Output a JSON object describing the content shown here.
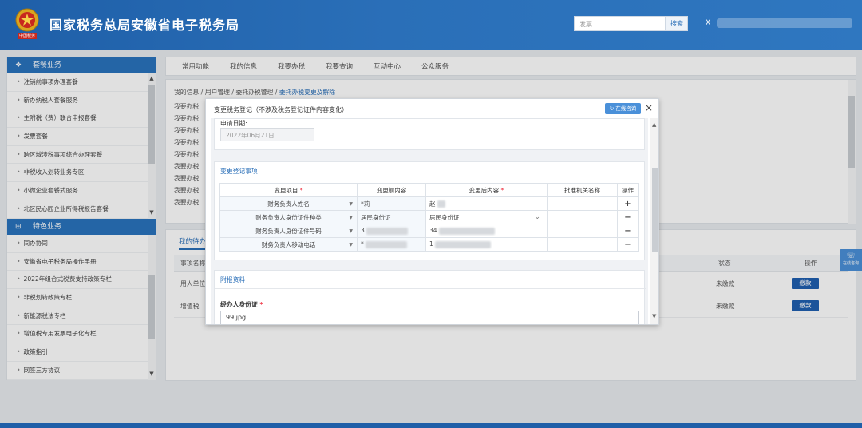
{
  "header": {
    "title": "国家税务总局安徽省电子税务局",
    "emblem_caption": "中国税务",
    "search_placeholder": "发票",
    "search_button": "搜索",
    "user_initial": "X"
  },
  "sidebar": {
    "section1": {
      "label": "套餐业务",
      "items": [
        "注销前事项办理套餐",
        "新办纳税人套餐服务",
        "主附税（费）联合申报套餐",
        "发票套餐",
        "跨区域涉税事项综合办理套餐",
        "非税收入划转业务专区",
        "小微企业套餐式服务",
        "北区民心园企业所得税报告套餐"
      ]
    },
    "section2": {
      "label": "特色业务",
      "items": [
        "同办协同",
        "安徽省电子税务局操作手册",
        "2022年组合式税费支持政策专栏",
        "非税划转政策专栏",
        "新能源税法专栏",
        "增值税专用发票电子化专栏",
        "政策指引",
        "网签三方协议"
      ]
    }
  },
  "nav": {
    "tabs": [
      "常用功能",
      "我的信息",
      "我要办税",
      "我要查询",
      "互动中心",
      "公众服务"
    ]
  },
  "breadcrumb": {
    "path": "我的信息 / 用户管理 / 委托办税管理 / ",
    "current": "委托办税变更及解除"
  },
  "bg_links": [
    "我要办税",
    "我要办税",
    "我要办税",
    "我要办税",
    "我要办税",
    "我要办税",
    "我要办税",
    "我要办税",
    "我要办税"
  ],
  "task_panel": {
    "tab": "我的待办",
    "columns": {
      "name": "事项名称",
      "status": "状态",
      "action": "操作"
    },
    "rows": [
      {
        "name": "用人单位",
        "status": "未缴款",
        "action": "缴款"
      },
      {
        "name": "增值税",
        "status": "未缴款",
        "action": "缴款"
      }
    ]
  },
  "float_button": "在线咨询",
  "modal": {
    "title": "变更税务登记（不涉及税务登记证件内容变化）",
    "consult_button": "在线咨询",
    "apply_date_label": "申请日期:",
    "apply_date_value": "2022年06月21日",
    "change_section": {
      "title": "变更登记事项",
      "headers": [
        "变更项目",
        "变更前内容",
        "变更后内容",
        "批准机关名称",
        "操作"
      ],
      "rows": [
        {
          "item": "财务负责人姓名",
          "before": "*莉",
          "after": "赵",
          "op": "+"
        },
        {
          "item": "财务负责人身份证件种类",
          "before": "居民身份证",
          "after": "居民身份证",
          "op": "−"
        },
        {
          "item": "财务负责人身份证件号码",
          "before": "3",
          "after": "34",
          "op": "−"
        },
        {
          "item": "财务负责人移动电话",
          "before": "*",
          "after": "1",
          "op": "−"
        }
      ]
    },
    "attach_section": {
      "title": "附报资料",
      "field_label": "经办人身份证",
      "file_value": "99.jpg"
    }
  }
}
